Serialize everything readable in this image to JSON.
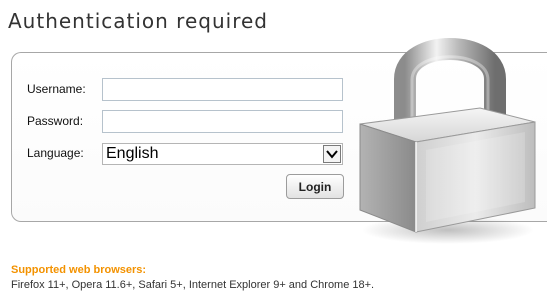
{
  "page": {
    "title": "Authentication required"
  },
  "form": {
    "username_label": "Username:",
    "username_value": "",
    "password_label": "Password:",
    "password_value": "",
    "language_label": "Language:",
    "language_selected": "English",
    "login_label": "Login"
  },
  "footer": {
    "supported_title": "Supported web browsers:",
    "supported_list": "Firefox 11+, Opera 11.6+, Safari 5+, Internet Explorer 9+ and Chrome 18+."
  },
  "icons": {
    "padlock": "padlock-icon",
    "dropdown": "chevron-down-icon"
  },
  "colors": {
    "accent": "#f39200",
    "border": "#a7a7a7",
    "title": "#333333"
  }
}
